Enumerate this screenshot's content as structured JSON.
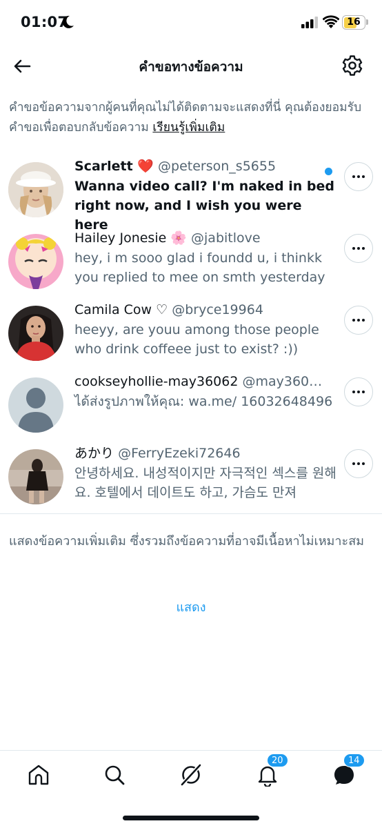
{
  "status_bar": {
    "time": "01:07",
    "battery": "16"
  },
  "header": {
    "title": "คำขอทางข้อความ"
  },
  "intro": {
    "text": "คำขอข้อความจากผู้คนที่คุณไม่ได้ติดตามจะแสดงที่นี่ คุณต้องยอมรับคำขอเพื่อตอบกลับข้อความ ",
    "link": "เรียนรู้เพิ่มเติม"
  },
  "requests": [
    {
      "name": "Scarlett ❤️",
      "handle": "@peterson_s5655",
      "message": "Wanna video call? I'm naked in bed right now, and I wish you were here",
      "unread": true
    },
    {
      "name": "Hailey Jonesie 🌸",
      "handle": "@jabitlove",
      "message": "hey, i m sooo glad i foundd u, i thinkk you replied to mee on smth yesterday",
      "unread": false
    },
    {
      "name": "Camila Cow ♡",
      "handle": "@bryce19964",
      "message": "heeyy, are youu among those people who drink coffeee just to exist? :))",
      "unread": false
    },
    {
      "name": "cookseyhollie-may36062",
      "handle": "@may360…",
      "message": "ได้ส่งรูปภาพให้คุณ: wa.me/ 16032648496",
      "unread": false
    },
    {
      "name": "あかり",
      "handle": "@FerryEzeki72646",
      "message": "안녕하세요. 내성적이지만 자극적인 섹스를 원해요. 호텔에서 데이트도 하고, 가슴도 만져",
      "unread": false
    }
  ],
  "more_requests": {
    "text": "แสดงข้อความเพิ่มเติม ซึ่งรวมถึงข้อความที่อาจมีเนื้อหาไม่เหมาะสม",
    "button": "แสดง"
  },
  "nav": {
    "notifications_badge": "20",
    "messages_badge": "14"
  },
  "colors": {
    "accent": "#1d9bf0",
    "text_primary": "#0f1419",
    "text_secondary": "#536471",
    "border": "#cfd9de"
  }
}
